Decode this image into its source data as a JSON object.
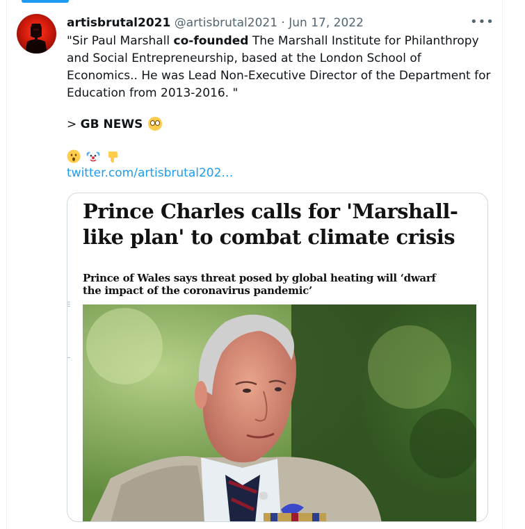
{
  "tweet": {
    "display_name": "artisbrutal2021",
    "handle": "@artisbrutal2021",
    "separator": "·",
    "date": "Jun 17, 2022",
    "more_icon": "more-horizontal-icon",
    "text": {
      "open_quote_part": "\"Sir Paul Marshall ",
      "bold_part": "co-founded",
      "rest_part": " The Marshall Institute for Philanthropy and Social Entrepreneurship, based at the London School of Economics.. He was Lead Non-Executive Director of the Department for Education from 2013-2016. \""
    },
    "source_prefix": "> ",
    "source_name": "GB NEWS",
    "source_emoji": "face-with-rolling-eyes-emoji",
    "emoji_row": [
      "hushed-face-emoji",
      "clown-face-emoji",
      "backhand-index-pointing-down-emoji"
    ],
    "link_text": "twitter.com/artisbrutal202…"
  },
  "card": {
    "headline": "Prince Charles calls for 'Marshall-like plan' to combat climate crisis",
    "subhead": "Prince of Wales says threat posed by global heating will ‘dwarf the impact of the coronavirus pandemic’",
    "image_subject": "photo-of-prince-charles"
  },
  "colors": {
    "accent": "#1d9bf0",
    "text": "#0f1419",
    "muted": "#536471",
    "border": "#cfd9de"
  }
}
